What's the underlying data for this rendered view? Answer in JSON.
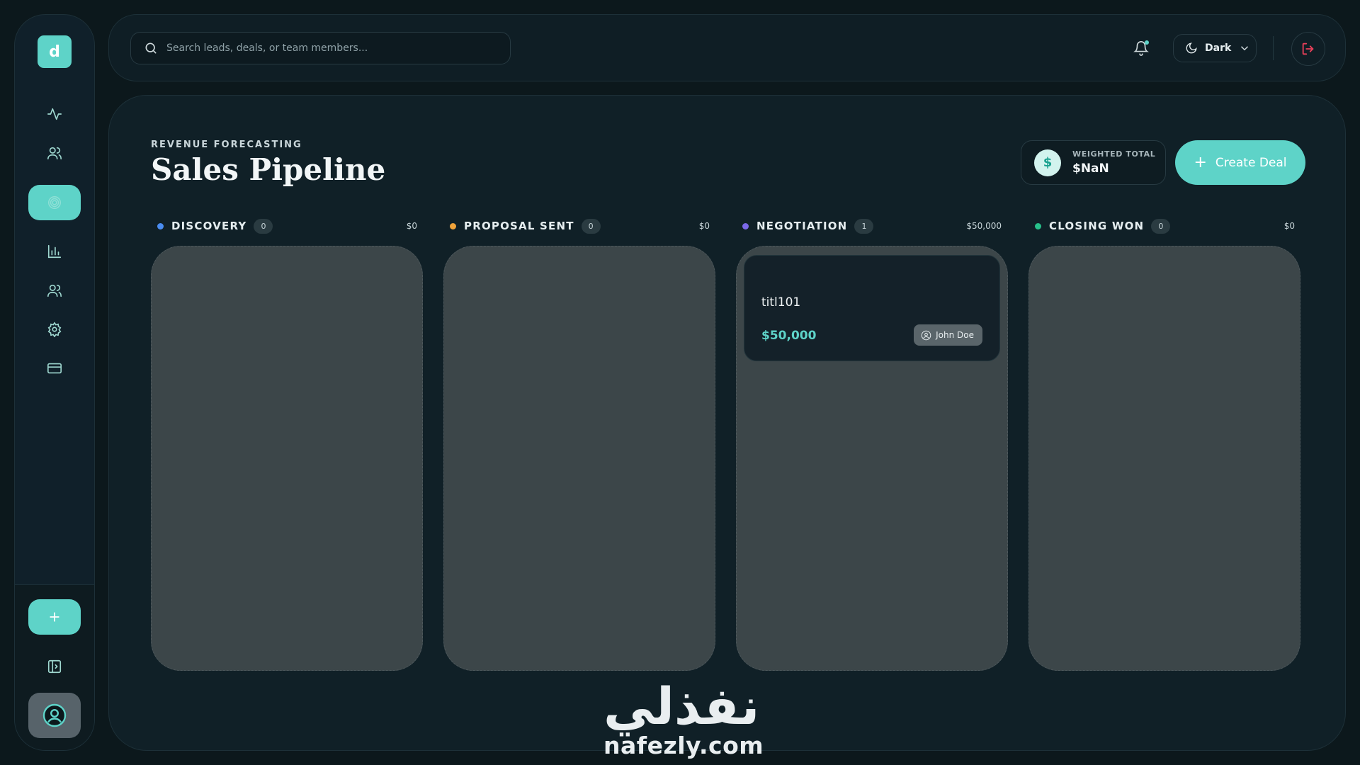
{
  "sidebar": {
    "logo_letter": "d",
    "nav": [
      {
        "icon": "activity-icon",
        "active": false
      },
      {
        "icon": "users-icon",
        "active": false
      },
      {
        "icon": "pipeline-icon",
        "active": true
      },
      {
        "icon": "bar-chart-icon",
        "active": false
      },
      {
        "icon": "team-icon",
        "active": false
      },
      {
        "icon": "gear-icon",
        "active": false
      },
      {
        "icon": "credit-card-icon",
        "active": false
      }
    ],
    "footer": {
      "add_icon": "plus-icon",
      "collapse_icon": "panel-toggle-icon",
      "avatar_icon": "user-circle-icon"
    }
  },
  "topbar": {
    "search": {
      "placeholder": "Search leads, deals, or team members..."
    },
    "theme": {
      "label": "Dark"
    }
  },
  "header": {
    "eyebrow": "REVENUE FORECASTING",
    "title": "Sales Pipeline",
    "weighted_total": {
      "label": "WEIGHTED TOTAL",
      "value": "$NaN"
    },
    "create_deal_label": "Create Deal"
  },
  "columns": [
    {
      "name": "DISCOVERY",
      "count": "0",
      "total": "$0",
      "color": "#4a8cf0",
      "deals": []
    },
    {
      "name": "PROPOSAL SENT",
      "count": "0",
      "total": "$0",
      "color": "#f0a33a",
      "deals": []
    },
    {
      "name": "NEGOTIATION",
      "count": "1",
      "total": "$50,000",
      "color": "#7b68e8",
      "deals": [
        {
          "title": "titl101",
          "amount": "$50,000",
          "owner": "John Doe"
        }
      ]
    },
    {
      "name": "CLOSING WON",
      "count": "0",
      "total": "$0",
      "color": "#27c08a",
      "deals": []
    }
  ],
  "watermark": {
    "arabic": "نفذلي",
    "latin": "nafezly.com"
  },
  "colors": {
    "accent": "#5ed3c8",
    "logout": "#e8405a"
  }
}
